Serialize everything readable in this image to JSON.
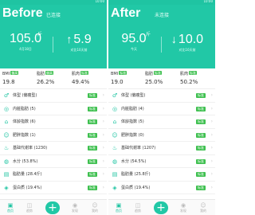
{
  "panels": [
    {
      "title": "Before",
      "status_text": "10:00",
      "subtitle": "已连接",
      "weight": "105.0",
      "weight_unit": "斤",
      "date": "4月18日",
      "change_arrow": "↑",
      "change": "5.9",
      "change_label": "对比10天前",
      "stats": [
        {
          "label": "BMI",
          "badge": "偏高",
          "badge_color": "#3ec04f",
          "value": "19.8"
        },
        {
          "label": "脂肪",
          "badge": "偏高",
          "badge_color": "#3ec04f",
          "value": "26.2%"
        },
        {
          "label": "肌肉",
          "badge": "标准",
          "badge_color": "#3ec04f",
          "value": "49.4%"
        }
      ],
      "rows": [
        {
          "icon": "body-type-icon",
          "glyph": "♂",
          "text": "体型 (偏瘦型)",
          "badge": "标准",
          "badge_color": "green"
        },
        {
          "icon": "visceral-fat-icon",
          "glyph": "◎",
          "text": "内脏脂肪 (5)",
          "badge": "标准",
          "badge_color": "green"
        },
        {
          "icon": "body-age-icon",
          "glyph": "⌂",
          "text": "体龄指数 (6)",
          "badge": "标准",
          "badge_color": "green"
        },
        {
          "icon": "obesity-icon",
          "glyph": "☺",
          "text": "肥胖指数 (1)",
          "badge": "标准",
          "badge_color": "green"
        },
        {
          "icon": "bmr-icon",
          "glyph": "♨",
          "text": "基础代谢率 (1230)",
          "badge": "标准",
          "badge_color": "green"
        },
        {
          "icon": "water-icon",
          "glyph": "◍",
          "text": "水分 (53.8%)",
          "badge": "标准",
          "badge_color": "green"
        },
        {
          "icon": "fat-mass-icon",
          "glyph": "▤",
          "text": "脂肪量 (28.4斤)",
          "badge": "标准",
          "badge_color": "green"
        },
        {
          "icon": "protein-icon",
          "glyph": "◈",
          "text": "蛋白质 (19.4%)",
          "badge": "标准",
          "badge_color": "green"
        }
      ],
      "tabs": [
        {
          "icon": "home-icon",
          "glyph": "▣",
          "label": "首页",
          "active": true
        },
        {
          "icon": "trend-icon",
          "glyph": "◫",
          "label": "趋势",
          "active": false
        },
        {
          "icon": "discover-icon",
          "glyph": "◉",
          "label": "发现",
          "active": false
        },
        {
          "icon": "profile-icon",
          "glyph": "☺",
          "label": "我的",
          "active": false
        }
      ]
    },
    {
      "title": "After",
      "status_text": "10:00",
      "subtitle": "未连接",
      "weight": "95.0",
      "weight_unit": "斤",
      "date": "今天",
      "change_arrow": "↓",
      "change": "10.0",
      "change_label": "对比10天前",
      "stats": [
        {
          "label": "BMI",
          "badge": "标准",
          "badge_color": "#3ec04f",
          "value": "19.0"
        },
        {
          "label": "脂肪",
          "badge": "标准",
          "badge_color": "#3ec04f",
          "value": "25.0%"
        },
        {
          "label": "肌肉",
          "badge": "标准",
          "badge_color": "#3ec04f",
          "value": "50.2%"
        }
      ],
      "rows": [
        {
          "icon": "body-type-icon",
          "glyph": "♂",
          "text": "体型 (偏瘦型)",
          "badge": "标准",
          "badge_color": "green"
        },
        {
          "icon": "visceral-fat-icon",
          "glyph": "◎",
          "text": "内脏脂肪 (4)",
          "badge": "标准",
          "badge_color": "green"
        },
        {
          "icon": "body-age-icon",
          "glyph": "⌂",
          "text": "体龄指数 (5)",
          "badge": "标准",
          "badge_color": "green"
        },
        {
          "icon": "obesity-icon",
          "glyph": "☺",
          "text": "肥胖指数 (0)",
          "badge": "标准",
          "badge_color": "green"
        },
        {
          "icon": "bmr-icon",
          "glyph": "♨",
          "text": "基础代谢率 (1207)",
          "badge": "标准",
          "badge_color": "green"
        },
        {
          "icon": "water-icon",
          "glyph": "◍",
          "text": "水分 (54.5%)",
          "badge": "标准",
          "badge_color": "green"
        },
        {
          "icon": "fat-mass-icon",
          "glyph": "▤",
          "text": "脂肪量 (25.8斤)",
          "badge": "标准",
          "badge_color": "green"
        },
        {
          "icon": "protein-icon",
          "glyph": "◈",
          "text": "蛋白质 (19.4%)",
          "badge": "标准",
          "badge_color": "green"
        }
      ],
      "tabs": [
        {
          "icon": "home-icon",
          "glyph": "▣",
          "label": "首页",
          "active": true
        },
        {
          "icon": "trend-icon",
          "glyph": "◫",
          "label": "趋势",
          "active": false
        },
        {
          "icon": "discover-icon",
          "glyph": "◉",
          "label": "发现",
          "active": false
        },
        {
          "icon": "profile-icon",
          "glyph": "☺",
          "label": "我的",
          "active": false
        }
      ]
    }
  ],
  "tab_plus_glyph": "+"
}
